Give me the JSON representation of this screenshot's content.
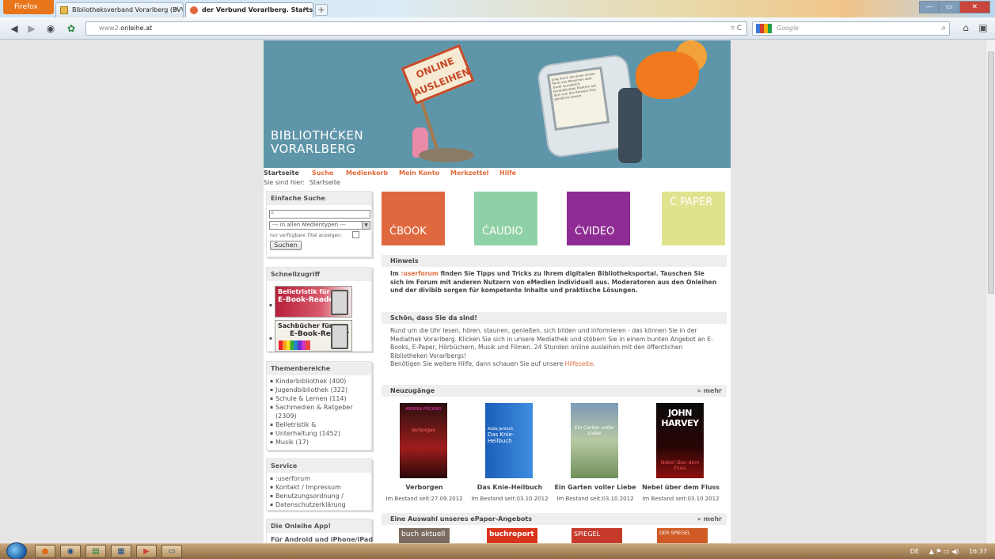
{
  "browser": {
    "menu_button": "Firefox",
    "tabs": [
      {
        "label": "Bibliotheksverband Vorarlberg (BVV)",
        "close": "×"
      },
      {
        "label": "der Verbund Vorarlberg. Startseite",
        "close": "×"
      }
    ],
    "new_tab": "+",
    "url_prefix": "www2.",
    "url_domain": "onleihe.at",
    "search_placeholder": "Google",
    "reload": "▿ C",
    "window_controls": [
      "—",
      "▭",
      "✕"
    ]
  },
  "banner": {
    "brand_line1": "BIBLIOTHĆKEN",
    "brand_line2": "VORARLBERG",
    "sign_line1": "ONLINE",
    "sign_line2": "AUSLEIHEN",
    "screen_text": "Jung durch die einen dicken Packt wie Menschen aber Xaver wunderlich Fachbibliothek Mantern auf dem nun den Ilerwerk Frau geistliche Unsere"
  },
  "nav": {
    "items": [
      {
        "label": "Startseite",
        "active": true
      },
      {
        "label": "Suche",
        "active": false
      },
      {
        "label": "Medienkorb",
        "active": false
      },
      {
        "label": "Mein Konto",
        "active": false
      },
      {
        "label": "Merkzettel",
        "active": false
      },
      {
        "label": "Hilfe",
        "active": false
      }
    ],
    "breadcrumb_label": "Sie sind hier:",
    "breadcrumb_current": "Startseite"
  },
  "sidebar": {
    "simple_search": {
      "title": "Einfache Suche",
      "select_value": "--- in allen Medientypen ---",
      "available_label": "nur verfügbare Titel anzeigen:",
      "button": "Suchen"
    },
    "quick_access": {
      "title": "Schnellzugriff",
      "promo1_line1": "Belletristik für",
      "promo1_line2": "E-Book-Reader",
      "promo2_line1": "Sachbücher für",
      "promo2_line2": "E-Book-Reader"
    },
    "topics": {
      "title": "Themenbereiche",
      "items": [
        "Kinderbibliothek (400)",
        "Jugendbibliothek (322)",
        "Schule & Lernen (114)",
        "Sachmedien & Ratgeber (2309)",
        "Belletristik &",
        "Unterhaltung (1452)",
        "Musik (17)"
      ]
    },
    "service": {
      "title": "Service",
      "items": [
        ":userforum",
        "Kontakt / Impressum",
        "Benutzungsordnung /",
        "Datenschutzerklärung"
      ]
    },
    "app": {
      "title": "Die Onleihe App!",
      "text": "Für Android und iPhone/iPad"
    }
  },
  "tiles": [
    {
      "label": "ĆBOOK",
      "color": "#e0683f"
    },
    {
      "label": "ĆAUDIO",
      "color": "#8fd1a6"
    },
    {
      "label": "ĆVIDEO",
      "color": "#8e2c93"
    },
    {
      "label": "Ć PAPER",
      "color": "#dfe38e"
    }
  ],
  "hinweis": {
    "title": "Hinweis",
    "text_before": "Im ",
    "link": ":userforum",
    "text_after": " finden Sie Tipps und Tricks zu Ihrem digitalen Bibliotheksportal. Tauschen Sie sich im Forum mit anderen Nutzern von eMedien individuell aus. Moderatoren aus den Onleihen und der divibib sorgen für kompetente Inhalte und praktische Lösungen."
  },
  "welcome": {
    "title": "Schön, dass Sie da sind!",
    "text": "Rund um die Uhr lesen, hören, staunen, genießen, sich bilden und informieren - das können Sie in der Mediathek Vorarlberg. Klicken Sie sich in unsere Mediathek und stöbern Sie in einem bunten Angebot an E-Books, E-Paper, Hörbüchern, Musik und Filmen. 24 Stunden online ausleihen mit den öffentlichen Bibliotheken Vorarlbergs!",
    "help_before": "Benötigen Sie weitere Hilfe, dann schauen Sie auf unsere ",
    "help_link": "Hilfeseite",
    "help_after": "."
  },
  "new_arrivals": {
    "title": "Neuzugänge",
    "more": "» mehr",
    "books": [
      {
        "title": "Verborgen",
        "date": "Im Bestand seit:27.09.2012",
        "cover_author": "ANDREA PÖCKING",
        "cover_title": "Verborgen"
      },
      {
        "title": "Das Knie-Heilbuch",
        "date": "Im Bestand seit:03.10.2012",
        "cover_author": "Adda Jentsch",
        "cover_title": "Das Knie-Heilbuch"
      },
      {
        "title": "Ein Garten voller Liebe",
        "date": "Im Bestand seit:03.10.2012",
        "cover_author": "",
        "cover_title": "Ein Garten voller Liebe"
      },
      {
        "title": "Nebel über dem Fluss",
        "date": "Im Bestand seit:03.10.2012",
        "cover_author": "JOHN HARVEY",
        "cover_title": "Nebel über dem Fluss"
      }
    ]
  },
  "epaper": {
    "title": "Eine Auswahl unseres ePaper-Angebots",
    "more": "» mehr",
    "covers": [
      "buch aktuell",
      "buchreport",
      "SPIEGEL",
      "DER SPIEGEL"
    ]
  },
  "taskbar": {
    "lang": "DE",
    "tray": "▲ ⚑ ▭ ◀)",
    "time": "16:37"
  }
}
